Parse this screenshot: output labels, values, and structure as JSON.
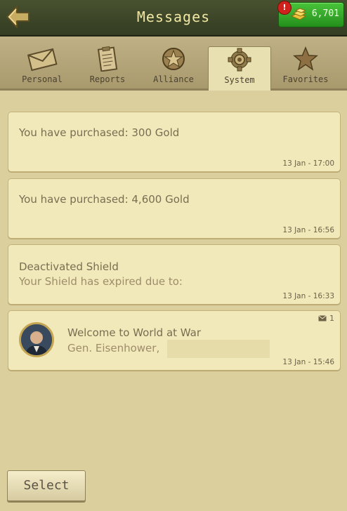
{
  "header": {
    "title": "Messages",
    "gold_count": "6,701",
    "alert_badge": "!"
  },
  "tabs": [
    {
      "label": "Personal",
      "icon": "envelope-icon",
      "active": false
    },
    {
      "label": "Reports",
      "icon": "clipboard-icon",
      "active": false
    },
    {
      "label": "Alliance",
      "icon": "alliance-star-icon",
      "active": false
    },
    {
      "label": "System",
      "icon": "gear-icon",
      "active": true
    },
    {
      "label": "Favorites",
      "icon": "star-icon",
      "active": false
    }
  ],
  "messages": [
    {
      "text": "You have purchased: 300 Gold",
      "time": "13 Jan - 17:00"
    },
    {
      "text": "You have purchased: 4,600 Gold",
      "time": "13 Jan - 16:56"
    },
    {
      "title": "Deactivated Shield",
      "subtitle": "Your Shield has expired due to:",
      "time": "13 Jan - 16:33"
    },
    {
      "title": "Welcome to World at War",
      "subtitle": "Gen. Eisenhower, ",
      "time": "13 Jan - 15:46",
      "count": "1"
    }
  ],
  "footer": {
    "select_label": "Select"
  },
  "colors": {
    "accent": "#2aa11f",
    "header_text": "#f1e7a4",
    "card_bg": "#f2e9bb"
  }
}
